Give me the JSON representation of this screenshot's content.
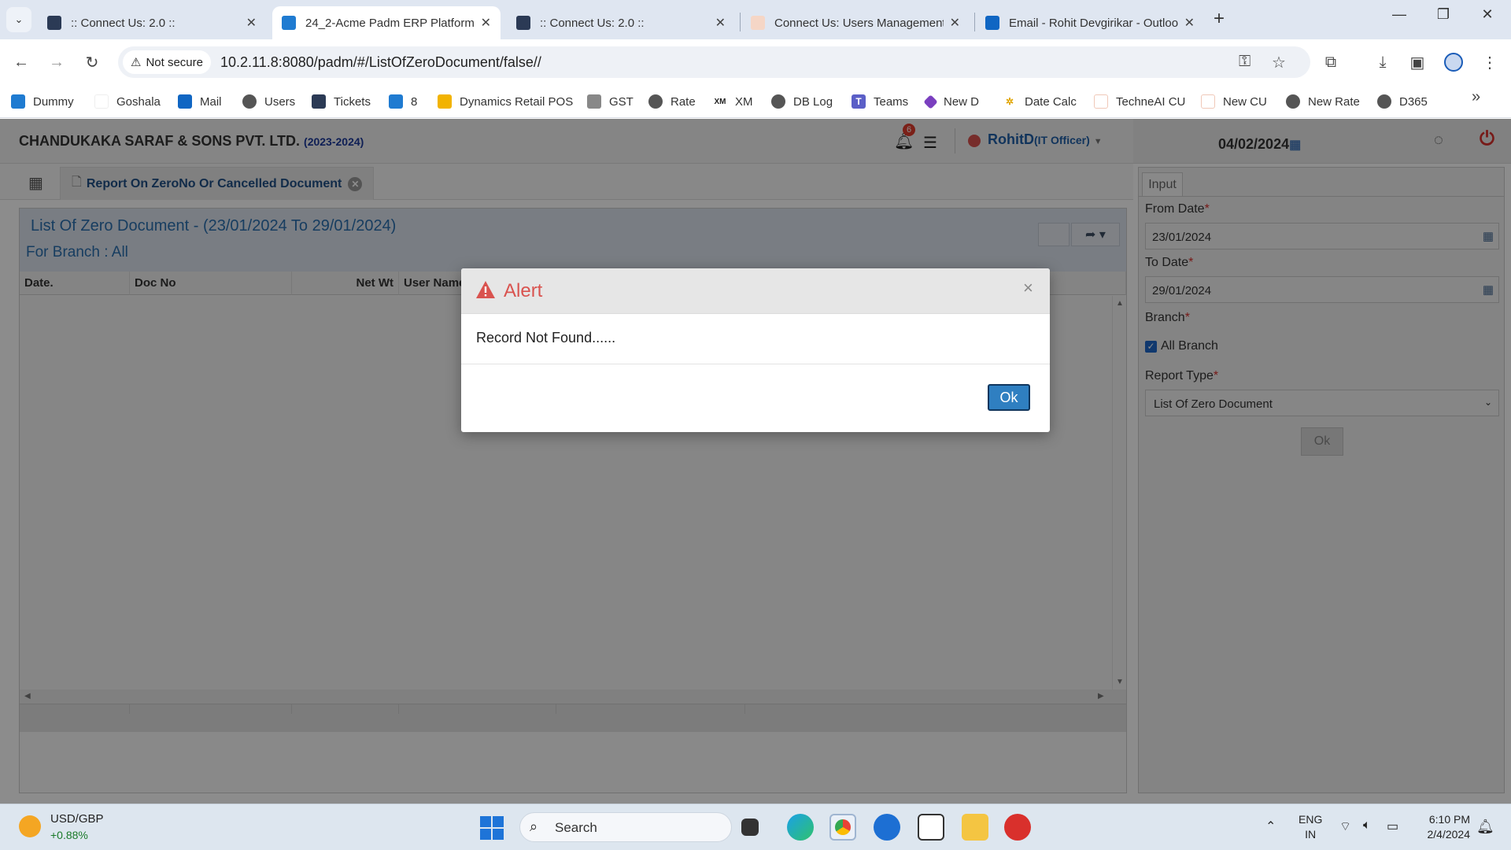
{
  "browser": {
    "tabs": [
      {
        "title": ":: Connect Us: 2.0 ::",
        "active": false
      },
      {
        "title": "24_2-Acme Padm ERP Platform",
        "active": true
      },
      {
        "title": ":: Connect Us: 2.0 ::",
        "active": false
      },
      {
        "title": "Connect Us: Users Management",
        "active": false
      },
      {
        "title": "Email - Rohit Devgirikar - Outlook",
        "active": false
      }
    ],
    "security_label": "Not secure",
    "url": "10.2.11.8:8080/padm/#/ListOfZeroDocument/false//",
    "bookmarks": [
      {
        "label": "Dummy",
        "icon": "erp-icon"
      },
      {
        "label": "Goshala",
        "icon": "page-icon"
      },
      {
        "label": "Mail",
        "icon": "outlook-icon"
      },
      {
        "label": "Users",
        "icon": "globe-icon"
      },
      {
        "label": "Tickets",
        "icon": "react-icon"
      },
      {
        "label": "8",
        "icon": "erp-icon"
      },
      {
        "label": "Dynamics Retail POS",
        "icon": "folder-icon"
      },
      {
        "label": "GST",
        "icon": "gst-icon"
      },
      {
        "label": "Rate",
        "icon": "globe-icon"
      },
      {
        "label": "XM",
        "icon": "xm-icon"
      },
      {
        "label": "DB Log",
        "icon": "globe-icon"
      },
      {
        "label": "Teams",
        "icon": "teams-icon"
      },
      {
        "label": "New D",
        "icon": "gem-icon"
      },
      {
        "label": "Date Calc",
        "icon": "dots-icon"
      },
      {
        "label": "TechneAI CU",
        "icon": "page-icon"
      },
      {
        "label": "New CU",
        "icon": "page-icon"
      },
      {
        "label": "New Rate",
        "icon": "globe-icon"
      },
      {
        "label": "D365",
        "icon": "globe-icon"
      }
    ]
  },
  "app": {
    "company": "CHANDUKAKA SARAF & SONS PVT. LTD.",
    "year": "(2023-2024)",
    "notification_count": "6",
    "user_name": "RohitD",
    "user_role": "(IT Officer)",
    "current_date": "04/02/2024",
    "breadcrumb_tab": "Report On ZeroNo Or Cancelled Document"
  },
  "report": {
    "title": "List Of Zero Document - (23/01/2024 To 29/01/2024)",
    "subtitle": "For Branch : All",
    "columns": [
      "Date.",
      "Doc No",
      "Net Wt",
      "User Name"
    ]
  },
  "input_panel": {
    "tab_label": "Input",
    "from_date_label": "From Date",
    "from_date_value": "23/01/2024",
    "to_date_label": "To Date",
    "to_date_value": "29/01/2024",
    "branch_label": "Branch",
    "all_branch_label": "All Branch",
    "all_branch_checked": true,
    "report_type_label": "Report Type",
    "report_type_value": "List Of Zero Document",
    "ok_label": "Ok",
    "required_mark": "*"
  },
  "alert": {
    "title": "Alert",
    "message": "Record Not Found......",
    "ok_label": "Ok",
    "close_glyph": "×",
    "accent_color": "#d9534f"
  },
  "taskbar": {
    "ticker_symbol": "USD/GBP",
    "ticker_change": "+0.88%",
    "search_label": "Search",
    "lang_line1": "ENG",
    "lang_line2": "IN",
    "time": "6:10 PM",
    "date": "2/4/2024"
  }
}
